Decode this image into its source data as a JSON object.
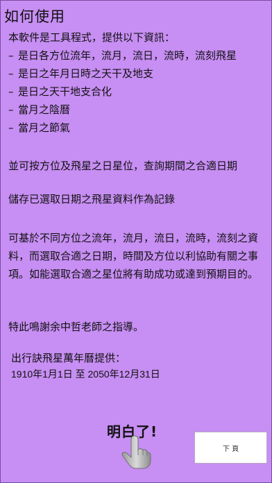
{
  "title": "如何使用",
  "intro": "本軟件是工具程式，提供以下資訊：",
  "features": [
    "是日各方位流年，流月，流日，流時，流刻飛星",
    "是日之年月日時之天干及地支",
    "是日之天干地支合化",
    "當月之陰曆",
    "當月之節氣"
  ],
  "paragraph_search": "並可按方位及飛星之日星位，查詢期間之合適日期",
  "paragraph_save": "儲存已選取日期之飛星資料作為記錄",
  "paragraph_use": "可基於不同方位之流年，流月，流日，流時，流刻之資料，而選取合適之日期，時間及方位以利協助有關之事項。如能選取合適之星位將有助成功或達到預期目的。",
  "thanks": "特此鳴謝余中哲老師之指導。",
  "provider": "出行訣飛星萬年曆提供：",
  "date_range": "1910年1月1日 至 2050年12月31日",
  "buttons": {
    "got_it": "明白了!",
    "next_page": "下 頁"
  },
  "icons": {
    "hand": "hand-pointer-icon"
  },
  "colors": {
    "background": "#c78ef3"
  }
}
